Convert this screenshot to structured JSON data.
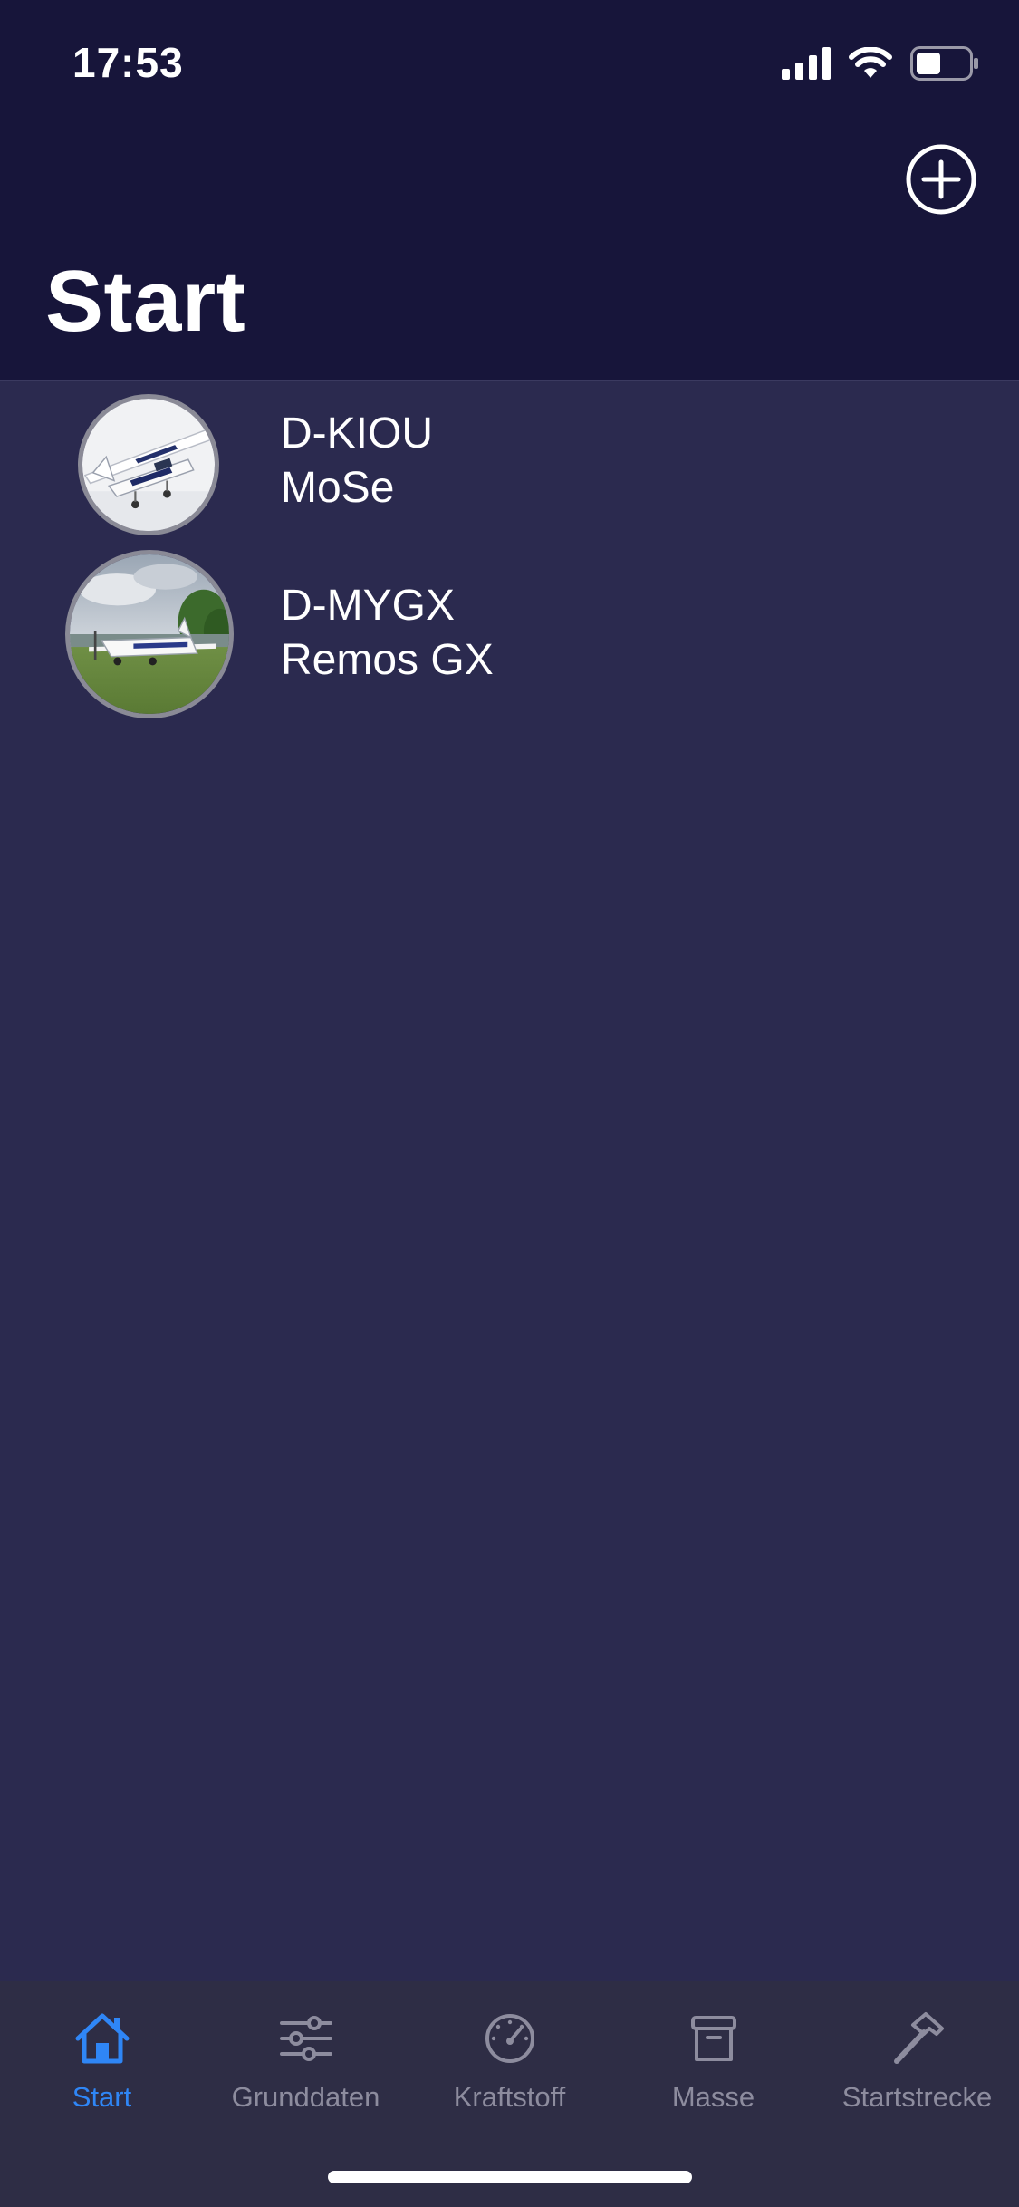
{
  "status_bar": {
    "time": "17:53",
    "icons": [
      "cellular-signal-icon",
      "wifi-icon",
      "battery-icon"
    ]
  },
  "header": {
    "title": "Start",
    "add_icon": "plus-circle-icon"
  },
  "aircraft": [
    {
      "registration": "D-KIOU",
      "model": "MoSe",
      "image": "airplane-photo"
    },
    {
      "registration": "D-MYGX",
      "model": "Remos GX",
      "image": "airplane-on-grass-photo"
    }
  ],
  "tab_bar": {
    "tabs": [
      {
        "label": "Start",
        "icon": "house-icon",
        "active": true
      },
      {
        "label": "Grunddaten",
        "icon": "sliders-icon",
        "active": false
      },
      {
        "label": "Kraftstoff",
        "icon": "gauge-icon",
        "active": false
      },
      {
        "label": "Masse",
        "icon": "archive-box-icon",
        "active": false
      },
      {
        "label": "Startstrecke",
        "icon": "hammer-icon",
        "active": false
      }
    ]
  },
  "colors": {
    "header_background": "#17153a",
    "content_background": "#2b2a4f",
    "tab_bar_background": "#2e2d45",
    "accent": "#2f86f6",
    "inactive_tab": "#8d8c9e",
    "text": "#ffffff"
  }
}
